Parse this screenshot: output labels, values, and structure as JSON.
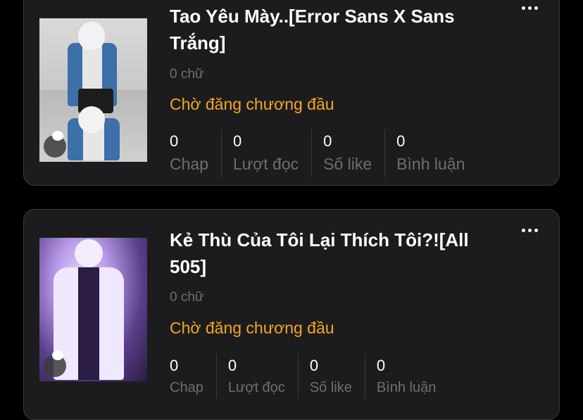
{
  "stories": [
    {
      "title": "Tao Yêu Mày..[Error Sans X Sans Trắng]",
      "word_count": "0 chữ",
      "status": "Chờ đăng chương đầu",
      "stats": [
        {
          "value": "0",
          "label": "Chap"
        },
        {
          "value": "0",
          "label": "Lượt đọc"
        },
        {
          "value": "0",
          "label": "Số like"
        },
        {
          "value": "0",
          "label": "Bình luận"
        }
      ]
    },
    {
      "title": "Kẻ Thù Của Tôi Lại Thích Tôi?![All 505]",
      "word_count": "0 chữ",
      "status": "Chờ đăng chương đầu",
      "stats": [
        {
          "value": "0",
          "label": "Chap"
        },
        {
          "value": "0",
          "label": "Lượt đọc"
        },
        {
          "value": "0",
          "label": "Số like"
        },
        {
          "value": "0",
          "label": "Bình luận"
        }
      ]
    }
  ],
  "icons": {
    "more": "more-options-icon",
    "comment": "comment-bubble-icon"
  },
  "colors": {
    "background": "#000000",
    "card": "#1c1c1e",
    "status": "#f5a623",
    "muted": "#6e6e72"
  }
}
